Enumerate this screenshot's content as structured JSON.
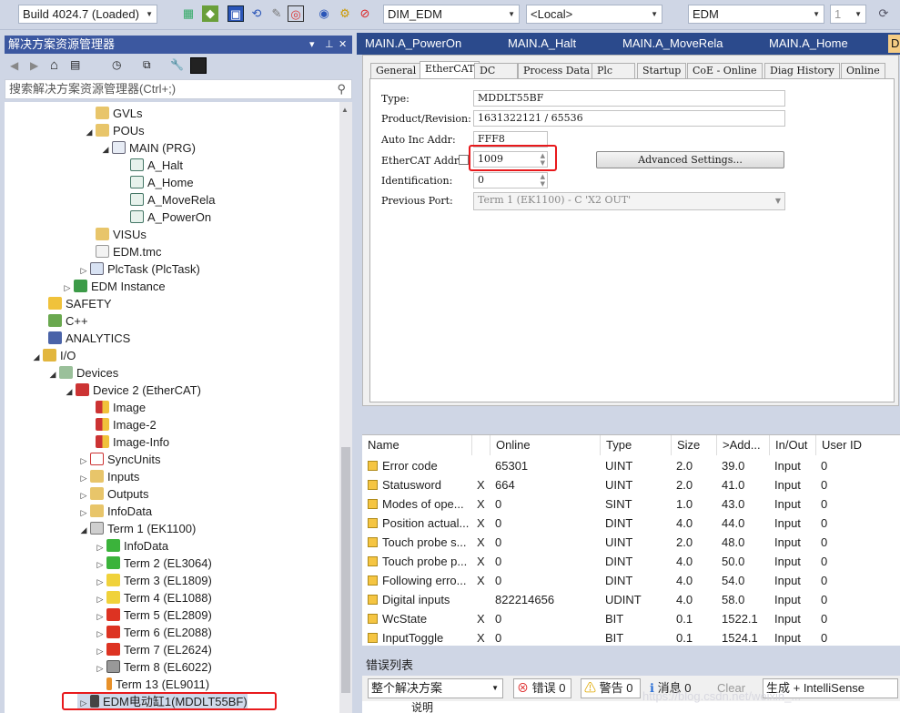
{
  "toolbar": {
    "build": "Build 4024.7 (Loaded)",
    "project": "DIM_EDM",
    "target": "<Local>",
    "plc": "EDM",
    "num": "1"
  },
  "solution_explorer": {
    "title": "解决方案资源管理器",
    "search_placeholder": "搜索解决方案资源管理器(Ctrl+;)",
    "tree": [
      "GVLs",
      "POUs",
      "MAIN (PRG)",
      "A_Halt",
      "A_Home",
      "A_MoveRela",
      "A_PowerOn",
      "VISUs",
      "EDM.tmc",
      "PlcTask (PlcTask)",
      "EDM Instance",
      "SAFETY",
      "C++",
      "ANALYTICS",
      "I/O",
      "Devices",
      "Device 2 (EtherCAT)",
      "Image",
      "Image-2",
      "Image-Info",
      "SyncUnits",
      "Inputs",
      "Outputs",
      "InfoData",
      "Term 1 (EK1100)",
      "InfoData",
      "Term 2 (EL3064)",
      "Term 3 (EL1809)",
      "Term 4 (EL1088)",
      "Term 5 (EL2809)",
      "Term 6 (EL2088)",
      "Term 7 (EL2624)",
      "Term 8 (EL6022)",
      "Term 13 (EL9011)",
      "EDM电动缸1(MDDLT55BF)"
    ]
  },
  "doc_tabs": [
    "MAIN.A_PowerOn",
    "MAIN.A_Halt",
    "MAIN.A_MoveRela",
    "MAIN.A_Home",
    "D"
  ],
  "prop_tabs": [
    "General",
    "EtherCAT",
    "DC",
    "Process Data",
    "Plc",
    "Startup",
    "CoE - Online",
    "Diag History",
    "Online"
  ],
  "ethercat": {
    "type_label": "Type:",
    "type": "MDDLT55BF",
    "product_label": "Product/Revision:",
    "product": "1631322121 / 65536",
    "auto_inc_label": "Auto Inc Addr:",
    "auto_inc": "FFF8",
    "addr_label": "EtherCAT Addr:",
    "addr": "1009",
    "ident_label": "Identification:",
    "ident": "0",
    "prev_port_label": "Previous Port:",
    "prev_port": "Term 1 (EK1100) - C 'X2 OUT'",
    "advanced": "Advanced Settings..."
  },
  "vars": {
    "headers": [
      "Name",
      "Online",
      "Type",
      "Size",
      ">Add...",
      "In/Out",
      "User ID"
    ],
    "rows": [
      [
        "Error code",
        "",
        "65301",
        "UINT",
        "2.0",
        "39.0",
        "Input",
        "0"
      ],
      [
        "Statusword",
        "X",
        "664",
        "UINT",
        "2.0",
        "41.0",
        "Input",
        "0"
      ],
      [
        "Modes of ope...",
        "X",
        "0",
        "SINT",
        "1.0",
        "43.0",
        "Input",
        "0"
      ],
      [
        "Position actual...",
        "X",
        "0",
        "DINT",
        "4.0",
        "44.0",
        "Input",
        "0"
      ],
      [
        "Touch probe s...",
        "X",
        "0",
        "UINT",
        "2.0",
        "48.0",
        "Input",
        "0"
      ],
      [
        "Touch probe p...",
        "X",
        "0",
        "DINT",
        "4.0",
        "50.0",
        "Input",
        "0"
      ],
      [
        "Following erro...",
        "X",
        "0",
        "DINT",
        "4.0",
        "54.0",
        "Input",
        "0"
      ],
      [
        "Digital inputs",
        "",
        "822214656",
        "UDINT",
        "4.0",
        "58.0",
        "Input",
        "0"
      ],
      [
        "WcState",
        "X",
        "0",
        "BIT",
        "0.1",
        "1522.1",
        "Input",
        "0"
      ],
      [
        "InputToggle",
        "X",
        "0",
        "BIT",
        "0.1",
        "1524.1",
        "Input",
        "0"
      ]
    ]
  },
  "errors": {
    "title": "错误列表",
    "scope": "整个解决方案",
    "errors": "错误 0",
    "warnings": "警告 0",
    "messages": "消息 0",
    "clear": "Clear",
    "build": "生成 + IntelliSense",
    "col": "说明"
  },
  "watermark": "https://blog.csdn.net/weixin_..."
}
